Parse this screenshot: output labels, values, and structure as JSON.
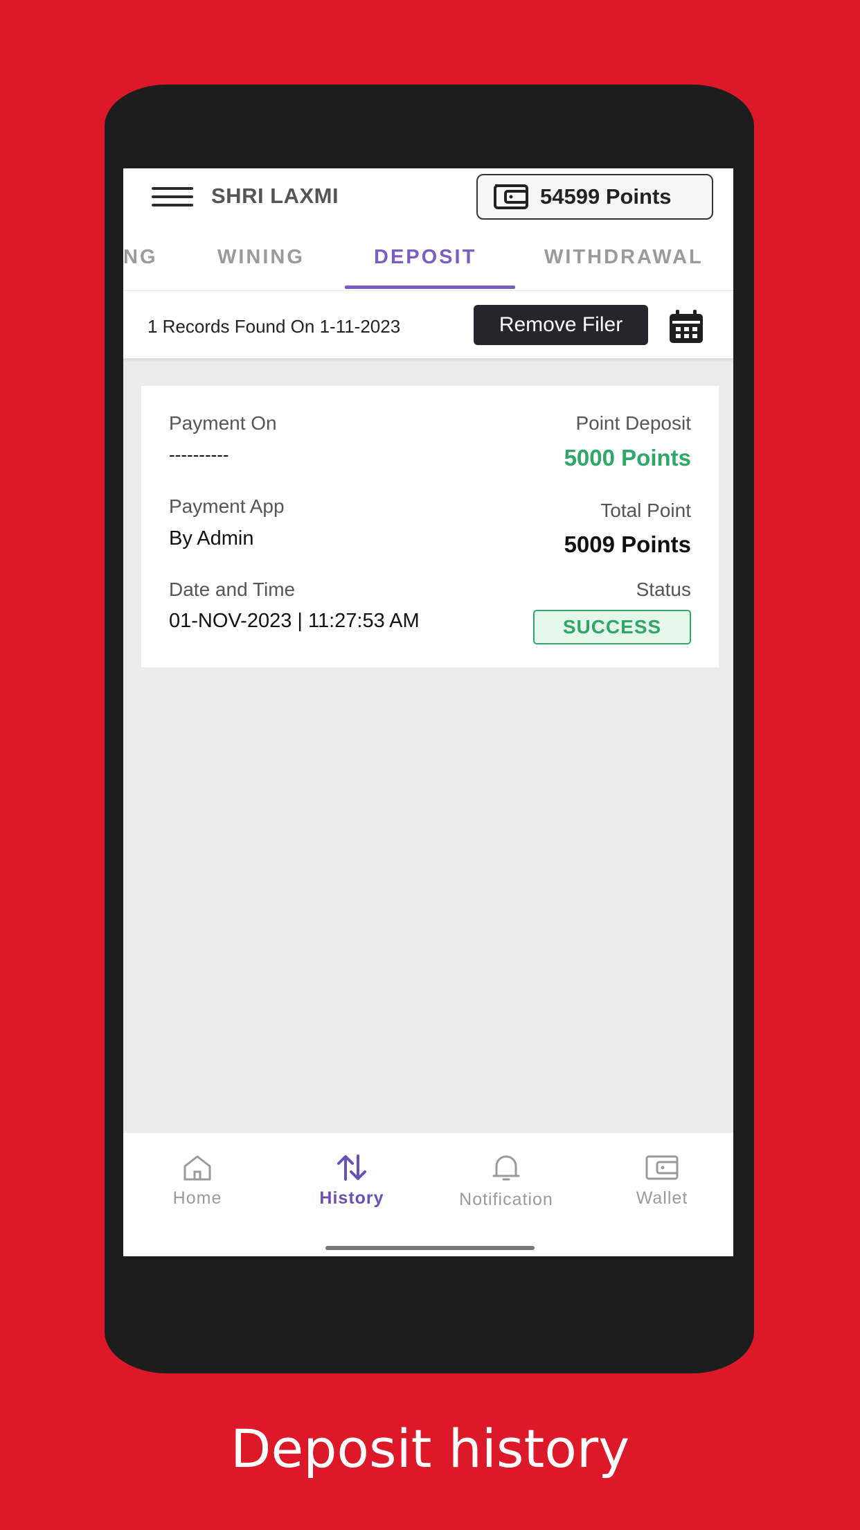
{
  "app": {
    "title": "SHRI LAXMI",
    "points_label": "54599 Points"
  },
  "tabs": [
    {
      "label": "NG"
    },
    {
      "label": "WINING"
    },
    {
      "label": "DEPOSIT"
    },
    {
      "label": "WITHDRAWAL"
    }
  ],
  "active_tab": "DEPOSIT",
  "filter": {
    "records_text": "1 Records Found On 1-11-2023",
    "remove_label": "Remove Filer"
  },
  "record": {
    "payment_on_label": "Payment On",
    "payment_on_value": "----------",
    "point_deposit_label": "Point Deposit",
    "point_deposit_value": "5000 Points",
    "payment_app_label": "Payment App",
    "payment_app_value": "By Admin",
    "total_point_label": "Total Point",
    "total_point_value": "5009 Points",
    "datetime_label": "Date and Time",
    "datetime_value": "01-NOV-2023 | 11:27:53 AM",
    "status_label": "Status",
    "status_value": "SUCCESS"
  },
  "bottom_nav": [
    {
      "label": "Home",
      "icon": "home-icon"
    },
    {
      "label": "History",
      "icon": "history-icon"
    },
    {
      "label": "Notification",
      "icon": "bell-icon"
    },
    {
      "label": "Wallet",
      "icon": "wallet-icon"
    }
  ],
  "caption": "Deposit history",
  "colors": {
    "background": "#dc1829",
    "accent": "#7b5cc3",
    "success": "#2ea768"
  }
}
